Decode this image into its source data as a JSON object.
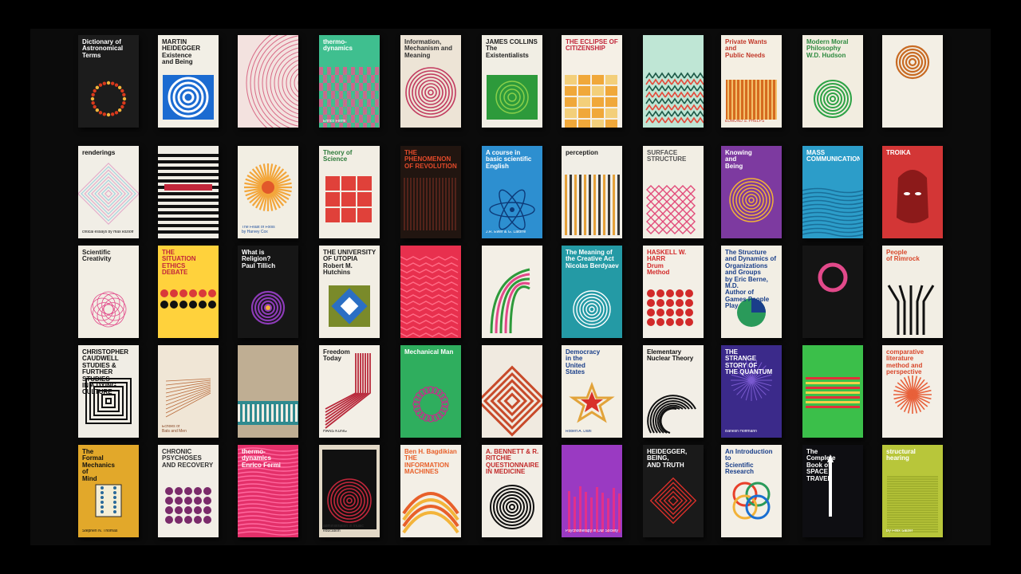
{
  "gallery": {
    "books": [
      {
        "title": "Dictionary of\nAstronomical\nTerms",
        "author": "",
        "bg": "#1c1c1c",
        "fg": "#ffffff",
        "accent": "#d8391c",
        "art": "ring-dots"
      },
      {
        "title": "MARTIN HEIDEGGER\nExistence\nand Being",
        "author": "",
        "bg": "#f2efe6",
        "fg": "#1a1a1a",
        "accent": "#1b6bd1",
        "art": "concentric-blue"
      },
      {
        "title": "",
        "author": "",
        "bg": "#f3e2df",
        "fg": "#c8526a",
        "accent": "#d86a86",
        "art": "arcs"
      },
      {
        "title": "thermo-\ndynamics",
        "author": "Enrico Fermi",
        "bg": "#3fbf8f",
        "fg": "#ffffff",
        "accent": "#e05b8c",
        "art": "check"
      },
      {
        "title": "Information, Mechanism and Meaning",
        "author": "",
        "bg": "#ede4d6",
        "fg": "#333333",
        "accent": "#c23a5f",
        "art": "rings-red"
      },
      {
        "title": "JAMES COLLINS\nThe\nExistentialists",
        "author": "",
        "bg": "#f1eee4",
        "fg": "#222222",
        "accent": "#2d9a3b",
        "art": "green-box"
      },
      {
        "title": "THE ECLIPSE OF CITIZENSHIP",
        "author": "",
        "bg": "#f5f0e6",
        "fg": "#c2273b",
        "accent": "#f0a83a",
        "art": "orange-tiles"
      },
      {
        "title": "",
        "author": "",
        "bg": "#bfe6d5",
        "fg": "#1e5a48",
        "accent": "#e44a3b",
        "art": "teal-pattern"
      },
      {
        "title": "Private Wants and\nPublic Needs",
        "author": "EDMUND S. PHELPS",
        "bg": "#f4efe3",
        "fg": "#c2392a",
        "accent": "#d66a1f",
        "art": "orange-stripes"
      },
      {
        "title": "Modern Moral Philosophy\nW.D. Hudson",
        "author": "",
        "bg": "#f2ede0",
        "fg": "#2e8a3f",
        "accent": "#2ea346",
        "art": "green-rings"
      },
      {
        "title": "",
        "author": "",
        "bg": "#f3efe5",
        "fg": "#6b3a18",
        "accent": "#c86a22",
        "art": "brown-rings"
      },
      {
        "title": "renderings",
        "author": "critical essays by max kozloff",
        "bg": "#f1eee6",
        "fg": "#111111",
        "accent": "#e2a3c6",
        "art": "diamond"
      },
      {
        "title": "",
        "author": "",
        "bg": "#f0ede5",
        "fg": "#111111",
        "accent": "#111111",
        "art": "hstripes"
      },
      {
        "title": "",
        "author": "The Feast of Fools\nby Harvey Cox",
        "bg": "#f2eee3",
        "fg": "#1f4f9d",
        "accent": "#f3a63b",
        "art": "sunburst"
      },
      {
        "title": "Theory of Science",
        "author": "",
        "bg": "#f2eee4",
        "fg": "#2d7a3a",
        "accent": "#e0413a",
        "art": "green-red"
      },
      {
        "title": "THE\nPHENOMENON\nOF REVOLUTION",
        "author": "",
        "bg": "#211510",
        "fg": "#e34a2a",
        "accent": "#53231a",
        "art": "dark-stripes"
      },
      {
        "title": "A course in\nbasic scientific\nEnglish",
        "author": "J.R. Ewer & G. Latorre",
        "bg": "#2d8fd0",
        "fg": "#ffffff",
        "accent": "#0d3a78",
        "art": "atom"
      },
      {
        "title": "perception",
        "author": "",
        "bg": "#f1eee6",
        "fg": "#222222",
        "accent": "#e5a13a",
        "art": "vstripes"
      },
      {
        "title": "SURFACE\nSTRUCTURE",
        "author": "",
        "bg": "#f2eee4",
        "fg": "#555555",
        "accent": "#e24b7a",
        "art": "pink-lattice"
      },
      {
        "title": "Knowing\nand\nBeing",
        "author": "",
        "bg": "#7d3aa0",
        "fg": "#ffffff",
        "accent": "#f2b238",
        "art": "purple-rings"
      },
      {
        "title": "MASS\nCOMMUNICATIONS",
        "author": "",
        "bg": "#2c9dc9",
        "fg": "#ffffff",
        "accent": "#1a6f9a",
        "art": "blue-waves"
      },
      {
        "title": "TROIKA",
        "author": "",
        "bg": "#d33636",
        "fg": "#ffffff",
        "accent": "#8c1a1a",
        "art": "red-head"
      },
      {
        "title": "Scientific Creativity",
        "author": "",
        "bg": "#f2eee4",
        "fg": "#222222",
        "accent": "#e2498a",
        "art": "pink-circles"
      },
      {
        "title": "THE\nSITUATION ETHICS\nDEBATE",
        "author": "",
        "bg": "#ffd23c",
        "fg": "#c2273b",
        "accent": "#d93a3a",
        "art": "dots-row"
      },
      {
        "title": "What is Religion?\nPaul Tillich",
        "author": "",
        "bg": "#161616",
        "fg": "#ffffff",
        "accent": "#8d3bb8",
        "art": "purple-target"
      },
      {
        "title": "THE UNIVERSITY OF UTOPIA\nRobert M. Hutchins",
        "author": "",
        "bg": "#f2eee4",
        "fg": "#222222",
        "accent": "#2b6fc4",
        "art": "square-target"
      },
      {
        "title": "",
        "author": "",
        "bg": "#e8304e",
        "fg": "#ffffff",
        "accent": "#ff6a84",
        "art": "red-zigzag"
      },
      {
        "title": "",
        "author": "",
        "bg": "#f3efe6",
        "fg": "#c22f6a",
        "accent": "#e2498a",
        "art": "pink-arcs"
      },
      {
        "title": "The Meaning of\nthe Creative Act\nNicolas Berdyaev",
        "author": "",
        "bg": "#249aa5",
        "fg": "#ffffff",
        "accent": "#14646c",
        "art": "teal-rings"
      },
      {
        "title": "HASKELL W. HARR\nDrum\nMethod",
        "author": "",
        "bg": "#f3efe6",
        "fg": "#d22a2a",
        "accent": "#d22a2a",
        "art": "red-dots"
      },
      {
        "title": "The Structure\nand Dynamics of\nOrganizations\nand Groups\nby Eric Berne, M.D.\nAuthor of\nGames People Play",
        "author": "",
        "bg": "#f2eee4",
        "fg": "#1a3f8a",
        "accent": "#2a9a5a",
        "art": "pie"
      },
      {
        "title": "",
        "author": "",
        "bg": "#141414",
        "fg": "#ffffff",
        "accent": "#e2498a",
        "art": "pink-ring"
      },
      {
        "title": "People\nof Rimrock",
        "author": "",
        "bg": "#f2eee4",
        "fg": "#d8462a",
        "accent": "#111111",
        "art": "arrows"
      },
      {
        "title": "CHRISTOPHER CAUDWELL\nSTUDIES & FURTHER STUDIES\nIN A DYING CULTURE",
        "author": "",
        "bg": "#f0ede5",
        "fg": "#111111",
        "accent": "#111111",
        "art": "squares"
      },
      {
        "title": "",
        "author": "Echoes of\nBats and Men",
        "bg": "#f0e6d6",
        "fg": "#8a4a2a",
        "accent": "#b86a3a",
        "art": "bat-lines"
      },
      {
        "title": "",
        "author": "",
        "bg": "#bfae93",
        "fg": "#333333",
        "accent": "#2f8a8f",
        "art": "teal-band"
      },
      {
        "title": "Freedom\nToday",
        "author": "HANS KÜNG",
        "bg": "#f3efe6",
        "fg": "#222222",
        "accent": "#b8283a",
        "art": "red-arrows"
      },
      {
        "title": "Mechanical Man",
        "author": "",
        "bg": "#2fae5e",
        "fg": "#ffffff",
        "accent": "#c2308a",
        "art": "pink-ring-green"
      },
      {
        "title": "",
        "author": "",
        "bg": "#f0eae0",
        "fg": "#7a2a1a",
        "accent": "#c84a2a",
        "art": "maze"
      },
      {
        "title": "Democracy\nin the\nUnited\nStates",
        "author": "Robert A. Dahl",
        "bg": "#f3efe4",
        "fg": "#1a3f8a",
        "accent": "#e2a33a",
        "art": "star"
      },
      {
        "title": "Elementary Nuclear Theory",
        "author": "",
        "bg": "#f2eee6",
        "fg": "#111111",
        "accent": "#111111",
        "art": "spiral"
      },
      {
        "title": "THE\nSTRANGE\nSTORY OF\nTHE QUANTUM",
        "author": "Banesh Hoffmann",
        "bg": "#3b2a8a",
        "fg": "#ffffff",
        "accent": "#7a5ad0",
        "art": "purple-burst"
      },
      {
        "title": "",
        "author": "",
        "bg": "#3bbf4a",
        "fg": "#ffffff",
        "accent": "#e2303a",
        "art": "green-red-stripes"
      },
      {
        "title": "comparative literature\nmethod and perspective",
        "author": "",
        "bg": "#f3efe6",
        "fg": "#d8462a",
        "accent": "#e8603a",
        "art": "orange-burst"
      },
      {
        "title": "The\nFormal\nMechanics\nof\nMind",
        "author": "Stephen N. Thomas",
        "bg": "#e2a82a",
        "fg": "#111111",
        "accent": "#2a2a2a",
        "art": "yellow-box"
      },
      {
        "title": "CHRONIC\nPSYCHOSES\nAND RECOVERY",
        "author": "",
        "bg": "#f2eee6",
        "fg": "#333333",
        "accent": "#7a2a6a",
        "art": "purple-dots"
      },
      {
        "title": "thermo-\ndynamics\nEnrico Fermi",
        "author": "",
        "bg": "#e4306a",
        "fg": "#ffffff",
        "accent": "#ff6aa0",
        "art": "pink-waves"
      },
      {
        "title": "",
        "author": "administration in music education",
        "bg": "#e2d8c6",
        "fg": "#333333",
        "accent": "#c2273b",
        "art": "red-vinyl"
      },
      {
        "title": "Ben H. Bagdikian\nTHE\nINFORMATION\nMACHINES",
        "author": "",
        "bg": "#f3efe6",
        "fg": "#e8602a",
        "accent": "#e8602a",
        "art": "orange-bands"
      },
      {
        "title": "A. BENNETT & R. RITCHIE\nQUESTIONNAIRES\nIN MEDICINE",
        "author": "",
        "bg": "#f2eee6",
        "fg": "#c22a2a",
        "accent": "#111111",
        "art": "bw-rings"
      },
      {
        "title": "",
        "author": "Psychotherapy in Our Society",
        "bg": "#9a3ac2",
        "fg": "#ffffff",
        "accent": "#e2308a",
        "art": "purple-bars"
      },
      {
        "title": "HEIDEGGER,\nBEING,\nAND TRUTH",
        "author": "",
        "bg": "#1a1a1a",
        "fg": "#ffffff",
        "accent": "#d8302a",
        "art": "red-diamond"
      },
      {
        "title": "An Introduction to\nScientific Research",
        "author": "",
        "bg": "#f3efe6",
        "fg": "#1a3f8a",
        "accent": "#e8402a",
        "art": "color-rings"
      },
      {
        "title": "The\nComplete\nBook of\nSPACE\nTRAVEL",
        "author": "",
        "bg": "#0e0e12",
        "fg": "#ffffff",
        "accent": "#ffffff",
        "art": "rocket"
      },
      {
        "title": "structural\nhearing",
        "author": "By Felix Salzer",
        "bg": "#b8c63a",
        "fg": "#ffffff",
        "accent": "#8a9a22",
        "art": "green-lines"
      }
    ]
  }
}
